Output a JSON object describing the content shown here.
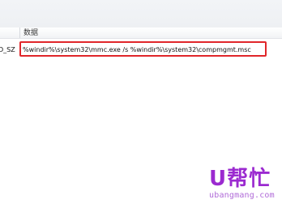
{
  "list_view": {
    "columns": [
      {
        "label": ""
      },
      {
        "label": "数据"
      }
    ],
    "rows": [
      {
        "type": "D_SZ",
        "data": "%windir%\\system32\\mmc.exe /s %windir%\\system32\\compmgmt.msc",
        "highlighted": true
      }
    ]
  },
  "colors": {
    "highlight": "#e0262a",
    "logo": "#9b2ad0"
  },
  "watermark": {
    "logo_text": "U帮忙",
    "site": "ubangmang.com"
  }
}
